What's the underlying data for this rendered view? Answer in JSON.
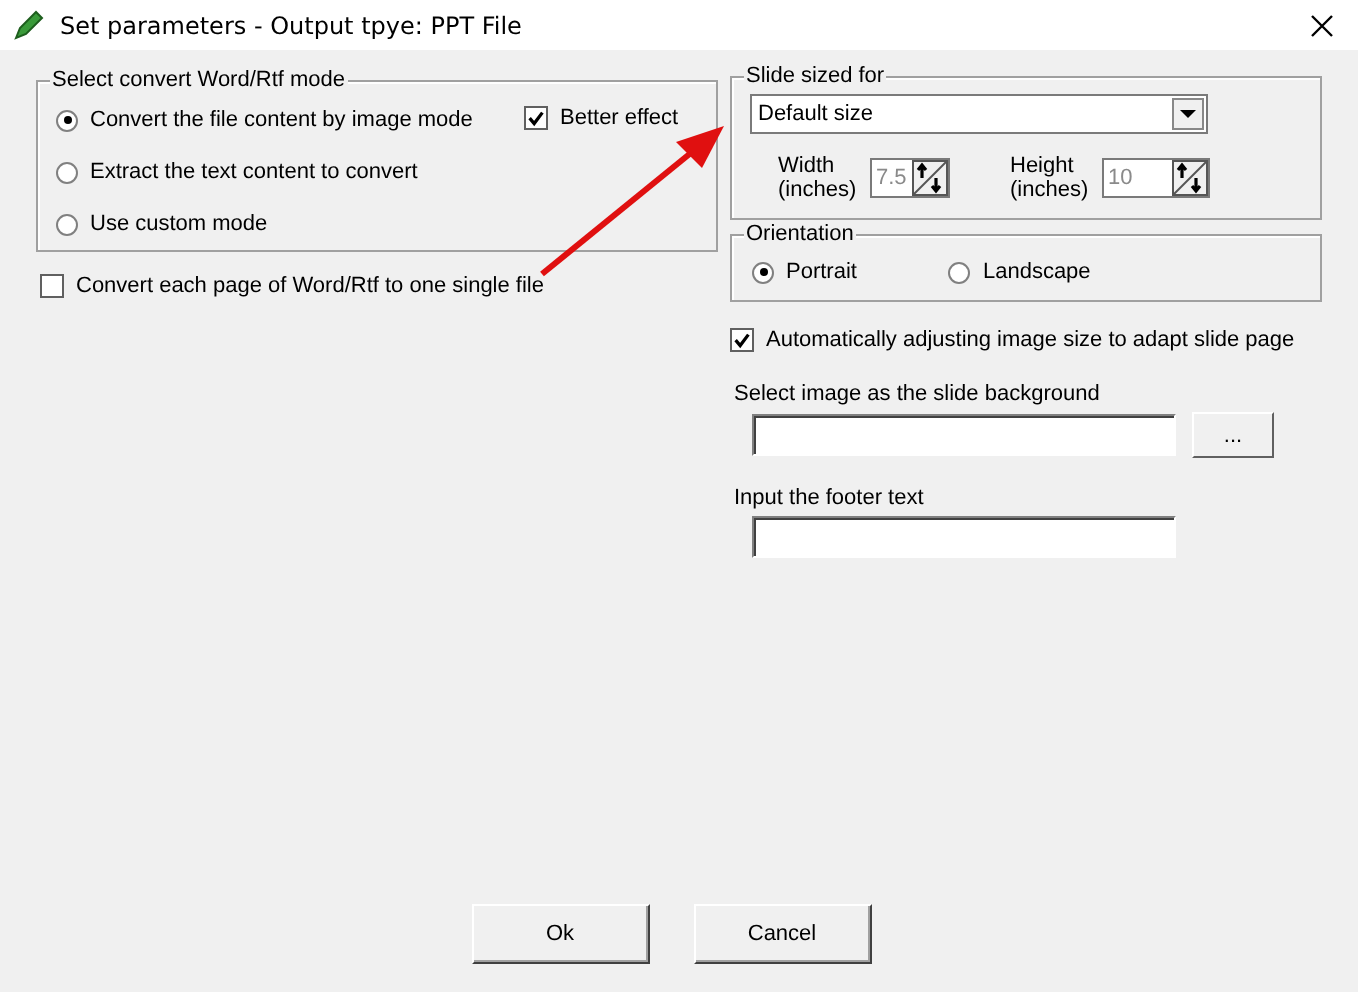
{
  "window": {
    "title": "Set parameters - Output tpye: PPT File"
  },
  "convert_mode": {
    "legend": "Select convert Word/Rtf mode",
    "options": [
      {
        "label": "Convert the file content by image mode",
        "selected": true
      },
      {
        "label": "Extract the text content to convert",
        "selected": false
      },
      {
        "label": "Use custom mode",
        "selected": false
      }
    ],
    "better_effect": {
      "label": "Better effect",
      "checked": true
    }
  },
  "single_file": {
    "label": "Convert each page of Word/Rtf to one single file",
    "checked": false
  },
  "slide_size": {
    "legend": "Slide sized for",
    "value": "Default size",
    "width": {
      "label": "Width (inches)",
      "value": "7.5",
      "disabled": true
    },
    "height": {
      "label": "Height (inches)",
      "value": "10",
      "disabled": true
    }
  },
  "orientation": {
    "legend": "Orientation",
    "options": [
      {
        "label": "Portrait",
        "selected": true
      },
      {
        "label": "Landscape",
        "selected": false
      }
    ]
  },
  "auto_adjust": {
    "label": "Automatically adjusting image size to adapt slide page",
    "checked": true
  },
  "background": {
    "label": "Select image as the slide background",
    "browse": "..."
  },
  "footer": {
    "label": "Input the footer text"
  },
  "buttons": [
    "Ok",
    "Cancel"
  ]
}
